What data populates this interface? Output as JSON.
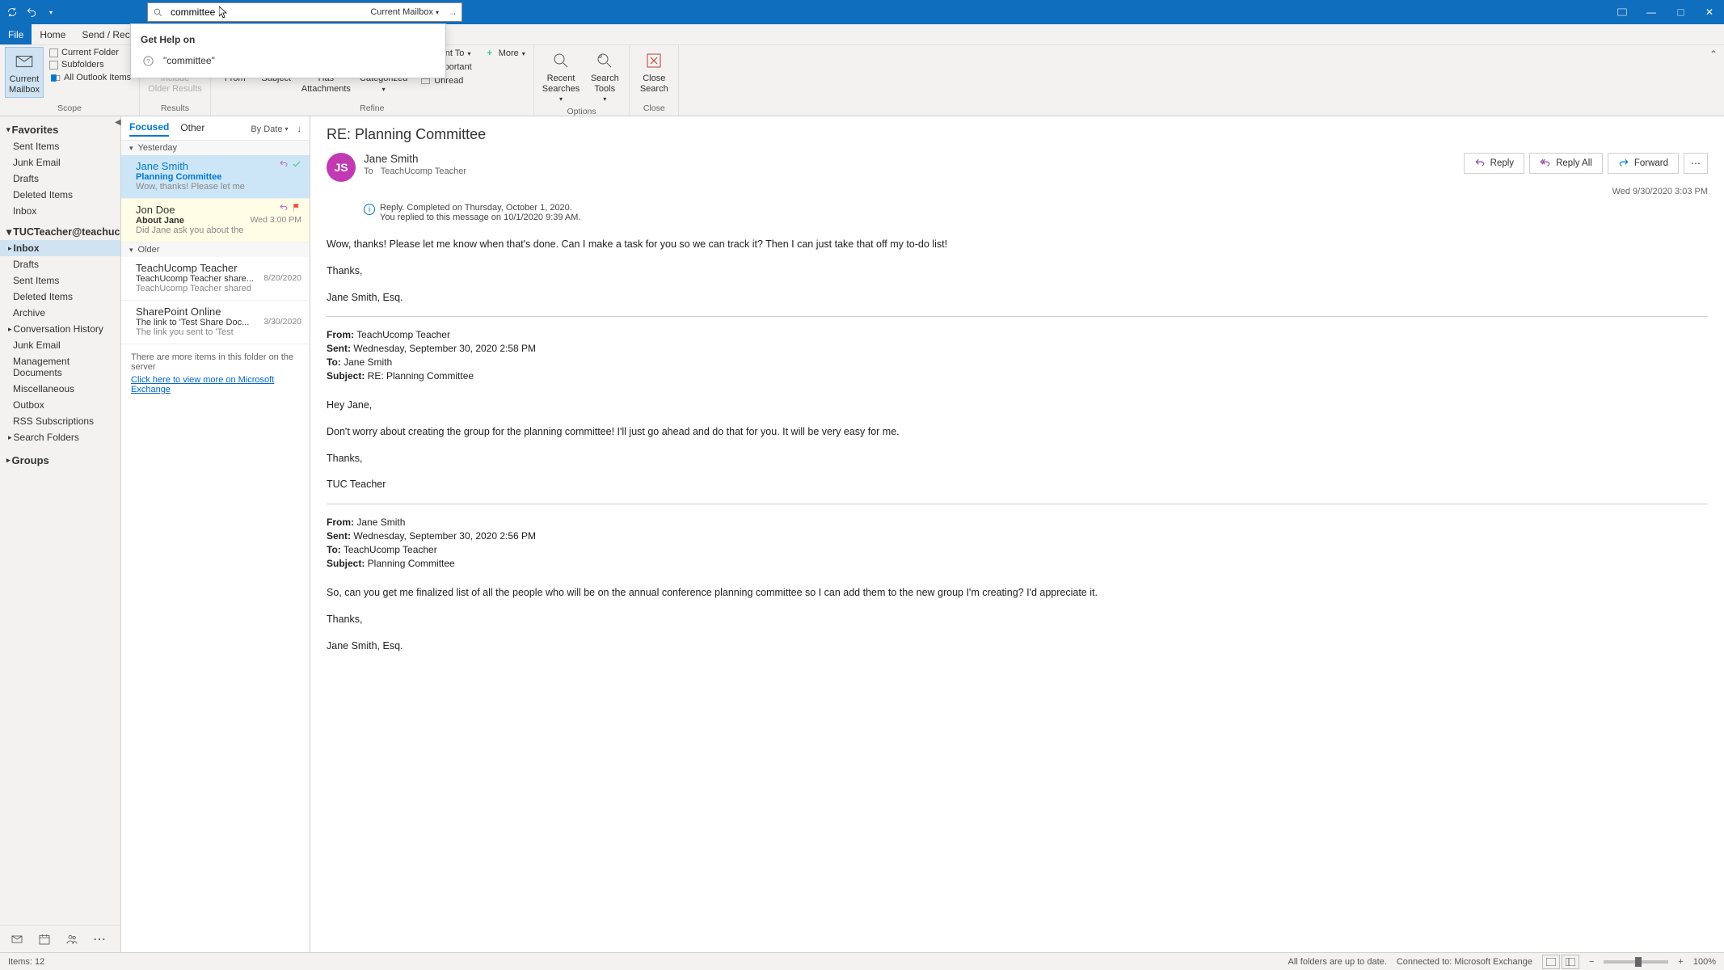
{
  "titlebar": {
    "search_value": "committee",
    "search_scope": "Current Mailbox"
  },
  "search_dropdown": {
    "header": "Get Help on",
    "item1": "\"committee\""
  },
  "menu": {
    "file": "File",
    "home": "Home",
    "sendrec": "Send / Rec"
  },
  "ribbon": {
    "scope": {
      "current_mailbox": "Current\nMailbox",
      "current_folder": "Current Folder",
      "subfolders": "Subfolders",
      "all_outlook": "All Outlook Items",
      "label": "Scope"
    },
    "results": {
      "include_older": "Include\nOlder Results",
      "label": "Results"
    },
    "refine": {
      "from": "From",
      "subject": "Subject",
      "has_attach": "Has\nAttachments",
      "categorized": "Categorized",
      "sent_to": "Sent To",
      "important": "Important",
      "unread": "Unread",
      "more": "More",
      "label": "Refine"
    },
    "options": {
      "recent": "Recent\nSearches",
      "tools": "Search\nTools",
      "label": "Options"
    },
    "close": {
      "close": "Close\nSearch",
      "label": "Close"
    }
  },
  "folders": {
    "favorites": "Favorites",
    "fav_items": [
      "Sent Items",
      "Junk Email",
      "Drafts",
      "Deleted Items",
      "Inbox"
    ],
    "account": "TUCTeacher@teachuc...",
    "items": [
      "Inbox",
      "Drafts",
      "Sent Items",
      "Deleted Items",
      "Archive",
      "Conversation History",
      "Junk Email",
      "Management Documents",
      "Miscellaneous",
      "Outbox",
      "RSS Subscriptions",
      "Search Folders"
    ],
    "groups": "Groups"
  },
  "list": {
    "tab_focused": "Focused",
    "tab_other": "Other",
    "sort": "By Date",
    "group1": "Yesterday",
    "group2": "Older",
    "m1": {
      "from": "Jane Smith",
      "subj": "Planning Committee",
      "prev": "Wow, thanks! Please let me"
    },
    "m2": {
      "from": "Jon Doe",
      "subj": "About Jane",
      "prev": "Did Jane ask you about the",
      "date": "Wed 3:00 PM"
    },
    "m3": {
      "from": "TeachUcomp Teacher",
      "subj": "TeachUcomp Teacher share...",
      "prev": "TeachUcomp Teacher shared",
      "date": "8/20/2020"
    },
    "m4": {
      "from": "SharePoint Online",
      "subj": "The link to 'Test Share Doc...",
      "prev": "The link you sent to 'Test",
      "date": "3/30/2020"
    },
    "more_text": "There are more items in this folder on the server",
    "more_link": "Click here to view more on Microsoft Exchange"
  },
  "reading": {
    "subject": "RE: Planning Committee",
    "avatar": "JS",
    "from": "Jane Smith",
    "to_label": "To",
    "to": "TeachUcomp Teacher",
    "reply": "Reply",
    "reply_all": "Reply All",
    "forward": "Forward",
    "timestamp": "Wed 9/30/2020 3:03 PM",
    "info1": "Reply.  Completed on Thursday, October 1, 2020.",
    "info2": "You replied to this message on 10/1/2020 9:39 AM.",
    "body": {
      "p1": "Wow, thanks! Please let me know when that's done. Can I make a task for you so we can track it? Then I can just take that off my to-do list!",
      "p2": "Thanks,",
      "p3": "Jane Smith, Esq.",
      "q1_from_l": "From:",
      "q1_from": " TeachUcomp Teacher",
      "q1_sent_l": "Sent:",
      "q1_sent": " Wednesday, September 30, 2020 2:58 PM",
      "q1_to_l": "To:",
      "q1_to": " Jane Smith",
      "q1_subj_l": "Subject:",
      "q1_subj": " RE: Planning Committee",
      "q1_p1": "Hey Jane,",
      "q1_p2": "Don't worry about creating the group for the planning committee! I'll just go ahead and do that for you. It will be very easy for me.",
      "q1_p3": "Thanks,",
      "q1_p4": "TUC Teacher",
      "q2_from_l": "From:",
      "q2_from": " Jane Smith",
      "q2_sent_l": "Sent:",
      "q2_sent": " Wednesday, September 30, 2020 2:56 PM",
      "q2_to_l": "To:",
      "q2_to": " TeachUcomp Teacher",
      "q2_subj_l": "Subject:",
      "q2_subj": " Planning Committee",
      "q2_p1": "So, can you get me  finalized list of all the people who will be on the annual conference planning committee so I can add them to the new group I'm creating? I'd appreciate it.",
      "q2_p2": "Thanks,",
      "q2_p3": "Jane Smith, Esq."
    }
  },
  "statusbar": {
    "items": "Items: 12",
    "sync": "All folders are up to date.",
    "conn": "Connected to: Microsoft Exchange",
    "zoom": "100%"
  }
}
